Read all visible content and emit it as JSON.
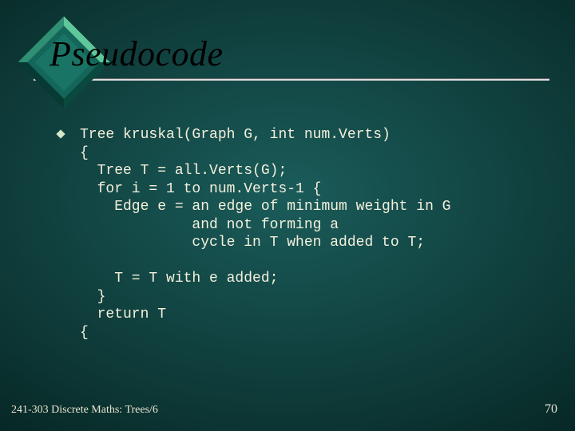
{
  "slide": {
    "title": "Pseudocode",
    "code_lines": [
      "Tree kruskal(Graph G, int num.Verts)",
      "{",
      "  Tree T = all.Verts(G);",
      "  for i = 1 to num.Verts-1 {",
      "    Edge e = an edge of minimum weight in G",
      "             and not forming a",
      "             cycle in T when added to T;",
      "",
      "    T = T with e added;",
      "  }",
      "  return T",
      "{"
    ],
    "footer_left": "241-303 Discrete Maths: Trees/6",
    "footer_right": "70"
  },
  "colors": {
    "bg_center": "#1a5c5a",
    "bg_edge": "#011614",
    "text": "#f5f0dc",
    "title": "#000000",
    "diamond_light": "#76d7aa",
    "diamond_dark": "#0a4a3e"
  }
}
